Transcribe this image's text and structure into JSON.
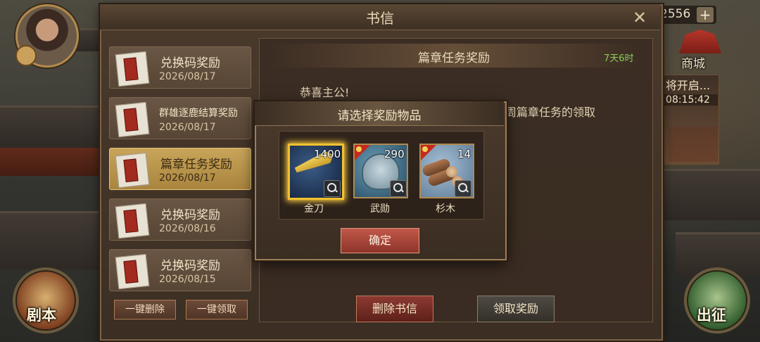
{
  "hud": {
    "resource_value": "2556",
    "resource_plus": "+",
    "shop_label": "商城",
    "event_title": "将开启...",
    "event_timer": "08:15:42",
    "story_label": "剧本",
    "march_label": "出征"
  },
  "mail": {
    "title": "书信",
    "close_symbol": "✕",
    "items": [
      {
        "title": "兑换码奖励",
        "date": "2026/08/17"
      },
      {
        "title": "群雄逐鹿结算奖励",
        "date": "2026/08/17"
      },
      {
        "title": "篇章任务奖励",
        "date": "2026/08/17"
      },
      {
        "title": "兑换码奖励",
        "date": "2026/08/16"
      },
      {
        "title": "兑换码奖励",
        "date": "2026/08/15"
      }
    ],
    "selected_index": 2,
    "delete_all_label": "一键删除",
    "claim_all_label": "一键领取",
    "content": {
      "title": "篇章任务奖励",
      "time_left": "7天6时",
      "greeting": "恭喜主公!",
      "body_fragment": "周篇章任务的领取"
    },
    "delete_label": "删除书信",
    "claim_label": "领取奖励"
  },
  "popup": {
    "title": "请选择奖励物品",
    "items": [
      {
        "name": "金刀",
        "quantity": "1400",
        "selected": true
      },
      {
        "name": "武勋",
        "quantity": "290",
        "selected": false
      },
      {
        "name": "杉木",
        "quantity": "14",
        "selected": false
      }
    ],
    "confirm_label": "确定"
  },
  "colors": {
    "selected_border": "#f0c030",
    "timer_green": "#8ccc5a",
    "confirm_red": "#c0584a"
  }
}
